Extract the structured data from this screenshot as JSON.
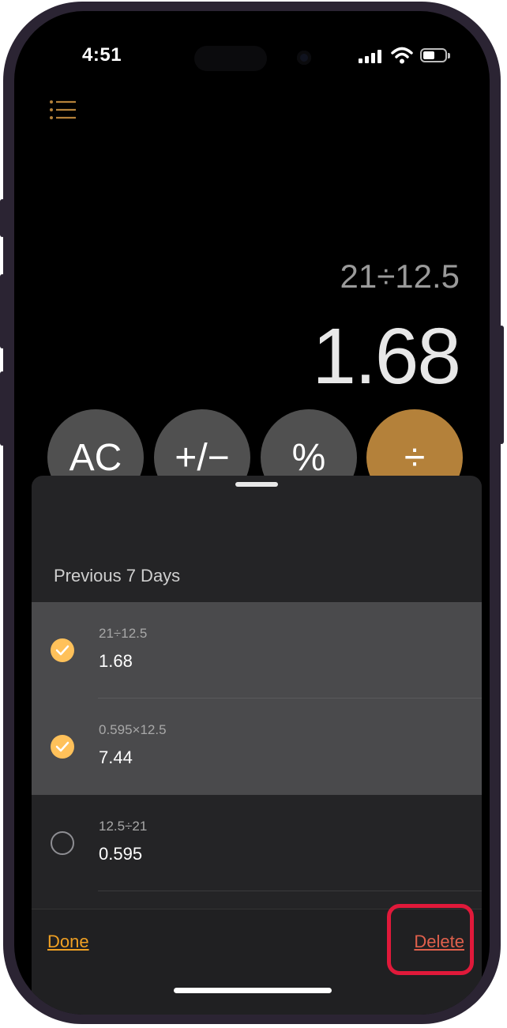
{
  "status_bar": {
    "time": "4:51",
    "icons": [
      "cellular-signal-icon",
      "wifi-icon",
      "battery-icon"
    ]
  },
  "toolbar_top": {
    "icon": "history-list-icon",
    "accent_color": "#f0a023"
  },
  "display": {
    "expression": "21÷12.5",
    "result": "1.68"
  },
  "keypad_row": [
    {
      "label": "AC",
      "style": "gray"
    },
    {
      "label": "+/−",
      "style": "gray"
    },
    {
      "label": "%",
      "style": "gray"
    },
    {
      "label": "÷",
      "style": "orange"
    }
  ],
  "history_sheet": {
    "section_title": "Previous 7 Days",
    "items": [
      {
        "expression": "21÷12.5",
        "value": "1.68",
        "selected": true
      },
      {
        "expression": "0.595×12.5",
        "value": "7.44",
        "selected": true
      },
      {
        "expression": "12.5÷21",
        "value": "0.595",
        "selected": false
      }
    ],
    "done_label": "Done",
    "delete_label": "Delete"
  },
  "colors": {
    "orange": "#b4813a",
    "check": "#ffc15a",
    "delete": "#e0604c",
    "highlight": "#e0193a"
  }
}
